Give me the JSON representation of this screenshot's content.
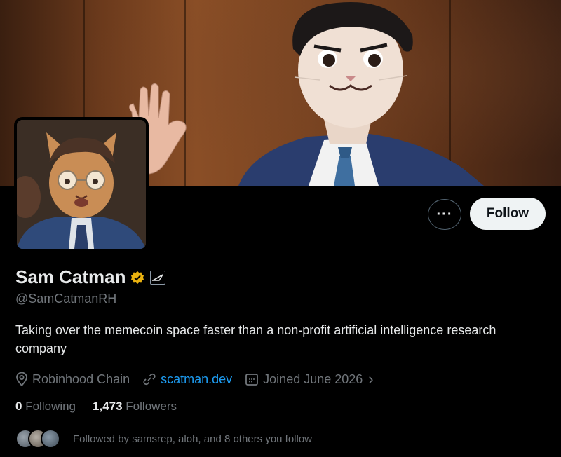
{
  "profile": {
    "display_name": "Sam Catman",
    "handle": "@SamCatmanRH",
    "bio": "Taking over the memecoin space faster than a non-profit artificial intelligence research company",
    "location": "Robinhood Chain",
    "website": "scatman.dev",
    "joined": "Joined June 2026",
    "verified_color": "#e9b10f"
  },
  "actions": {
    "more_label": "···",
    "follow_label": "Follow"
  },
  "stats": {
    "following_count": "0",
    "following_label": "Following",
    "followers_count": "1,473",
    "followers_label": "Followers"
  },
  "followed_by": {
    "text": "Followed by samsrep, aloh, and 8 others you follow"
  },
  "colors": {
    "accent_link": "#1d9bf0",
    "muted_text": "#71767b",
    "background": "#000000"
  }
}
